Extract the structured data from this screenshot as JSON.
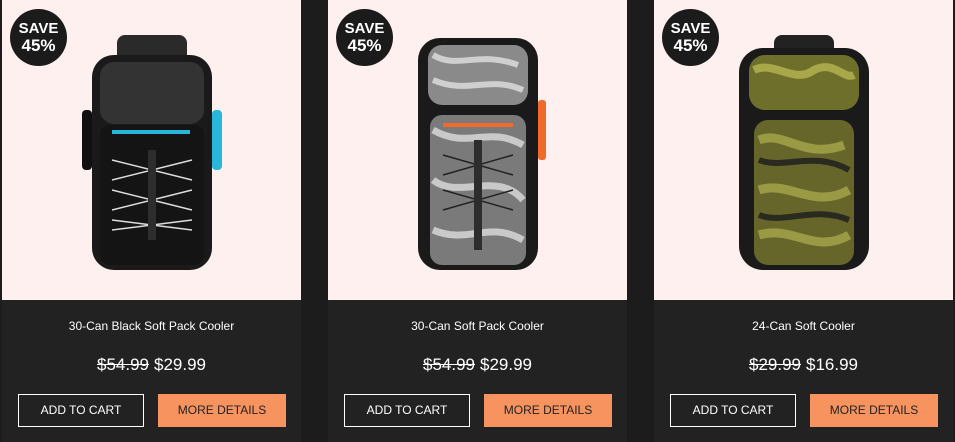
{
  "products": [
    {
      "badge_save": "SAVE",
      "badge_pct": "45%",
      "title": "30-Can Black Soft Pack Cooler",
      "old_price": "$54.99",
      "new_price": "$29.99",
      "add_to_cart": "ADD TO CART",
      "more_details": "MORE DETAILS",
      "image_icon": "black-backpack-cooler-icon",
      "accent": "#28b7d9"
    },
    {
      "badge_save": "SAVE",
      "badge_pct": "45%",
      "title": "30-Can Soft Pack Cooler",
      "old_price": "$54.99",
      "new_price": "$29.99",
      "add_to_cart": "ADD TO CART",
      "more_details": "MORE DETAILS",
      "image_icon": "marble-backpack-cooler-icon",
      "accent": "#f06a2b"
    },
    {
      "badge_save": "SAVE",
      "badge_pct": "45%",
      "title": "24-Can Soft Cooler",
      "old_price": "$29.99",
      "new_price": "$16.99",
      "add_to_cart": "ADD TO CART",
      "more_details": "MORE DETAILS",
      "image_icon": "camo-backpack-cooler-icon",
      "accent": "#6f6f2c"
    }
  ],
  "colors": {
    "page_bg": "#1c1c1c",
    "card_bg": "#222222",
    "image_bg": "#fdf0ee",
    "button_accent": "#f7935e"
  }
}
